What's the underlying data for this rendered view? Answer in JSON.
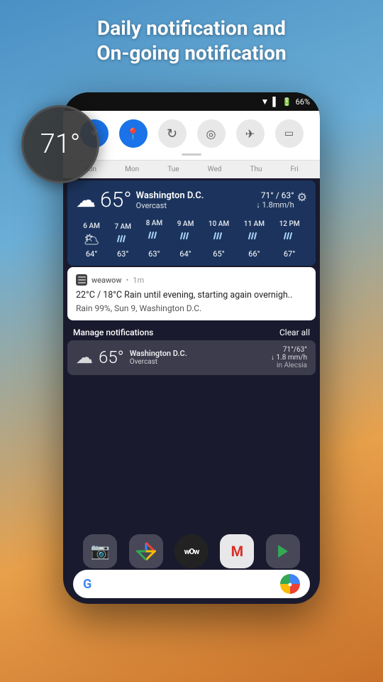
{
  "header": {
    "line1": "Daily notification and",
    "line2": "On-going notification"
  },
  "temp_bubble": {
    "temperature": "71°"
  },
  "status_bar": {
    "battery_pct": "66%",
    "battery_icon": "🔋"
  },
  "quick_settings": {
    "icons": [
      {
        "name": "dropdown",
        "active": true,
        "symbol": "▼"
      },
      {
        "name": "location",
        "active": true,
        "symbol": "📍"
      },
      {
        "name": "sync",
        "active": false,
        "symbol": "↻"
      },
      {
        "name": "hotspot",
        "active": false,
        "symbol": "◎"
      },
      {
        "name": "airplane",
        "active": false,
        "symbol": "✈"
      },
      {
        "name": "cast",
        "active": false,
        "symbol": "▭"
      }
    ]
  },
  "calendar": {
    "days": [
      "Sun",
      "Mon",
      "Tue",
      "Wed",
      "Thu",
      "Fri"
    ]
  },
  "weather_card": {
    "cloud_icon": "☁",
    "temperature": "65°",
    "location": "Washington D.C.",
    "condition": "Overcast",
    "high": "71°",
    "low": "63°",
    "precip": "↓ 1.8mm/h",
    "gear": "⚙",
    "hourly": [
      {
        "time": "6 AM",
        "icon": "🌥",
        "temp": "64°"
      },
      {
        "time": "7 AM",
        "icon": "🌧",
        "temp": "63°"
      },
      {
        "time": "8 AM",
        "icon": "🌧",
        "temp": "63°"
      },
      {
        "time": "9 AM",
        "icon": "🌧",
        "temp": "64°"
      },
      {
        "time": "10 AM",
        "icon": "🌧",
        "temp": "65°"
      },
      {
        "time": "11 AM",
        "icon": "🌧",
        "temp": "66°"
      },
      {
        "time": "12 PM",
        "icon": "🌧",
        "temp": "67°"
      }
    ]
  },
  "notification": {
    "app_name": "weawow",
    "time_ago": "1m",
    "body_line1": "22°C / 18°C Rain until evening, starting again overnigh..",
    "body_line2": "Rain 99%, Sun 9, Washington D.C."
  },
  "manage_bar": {
    "label": "Manage notifications",
    "clear_all": "Clear all"
  },
  "mini_weather": {
    "cloud_icon": "☁",
    "temperature": "65°",
    "location": "Washington D.C.",
    "condition": "Overcast",
    "high_low": "71°/63°",
    "precip": "↓ 1.8 mm/h",
    "extra": "in Alecsia"
  },
  "dock": {
    "apps": [
      {
        "name": "Camera",
        "icon": "📷"
      },
      {
        "name": "Photos",
        "icon": "🎨"
      },
      {
        "name": "WoW",
        "label": "wOw"
      },
      {
        "name": "Gmail",
        "icon": "M"
      },
      {
        "name": "Play",
        "icon": "▶"
      }
    ]
  },
  "search_bar": {
    "g_logo": "G",
    "mic_symbol": "●"
  }
}
